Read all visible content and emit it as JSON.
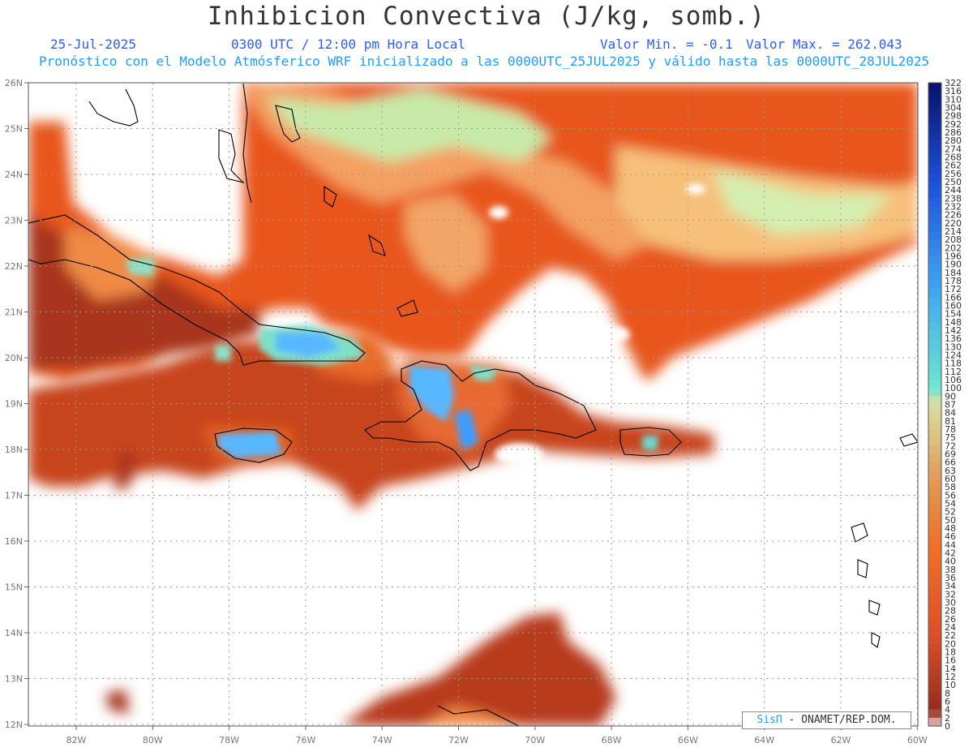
{
  "header": {
    "title": "Inhibicion Convectiva (J/kg, somb.)",
    "date": "25-Jul-2025",
    "time": "0300 UTC / 12:00 pm Hora Local",
    "valmin": "Valor Min. = -0.1",
    "valmax": "Valor Max. = 262.043",
    "subtitle": "Pronóstico con el Modelo Atmósferico WRF inicializado a las 0000UTC_25JUL2025 y válido hasta las  0000UTC_28JUL2025"
  },
  "map": {
    "lat_labels": [
      "26N",
      "25N",
      "24N",
      "23N",
      "22N",
      "21N",
      "20N",
      "19N",
      "18N",
      "17N",
      "16N",
      "15N",
      "14N",
      "13N",
      "12N"
    ],
    "lon_labels": [
      "82W",
      "80W",
      "78W",
      "76W",
      "74W",
      "72W",
      "70W",
      "68W",
      "66W",
      "64W",
      "62W",
      "60W"
    ]
  },
  "colorbar": {
    "labels": [
      "322",
      "316",
      "310",
      "304",
      "298",
      "292",
      "286",
      "280",
      "274",
      "268",
      "262",
      "256",
      "250",
      "244",
      "238",
      "232",
      "226",
      "220",
      "214",
      "208",
      "202",
      "196",
      "190",
      "184",
      "178",
      "172",
      "166",
      "160",
      "154",
      "148",
      "142",
      "136",
      "130",
      "124",
      "118",
      "112",
      "106",
      "100",
      "90",
      "87",
      "84",
      "81",
      "78",
      "75",
      "72",
      "69",
      "66",
      "63",
      "60",
      "58",
      "56",
      "54",
      "52",
      "50",
      "48",
      "46",
      "44",
      "42",
      "40",
      "38",
      "36",
      "34",
      "32",
      "30",
      "28",
      "26",
      "24",
      "22",
      "20",
      "18",
      "16",
      "14",
      "12",
      "10",
      "8",
      "6",
      "4",
      "2",
      "0"
    ]
  },
  "credit": {
    "logo": "SisΠ",
    "text": " - ONAMET/REP.DOM."
  },
  "colors": {
    "low": "#8b2a1e",
    "mid": "#e8551a",
    "high": "#c8f0b0",
    "peak": "#2aa0ff"
  }
}
